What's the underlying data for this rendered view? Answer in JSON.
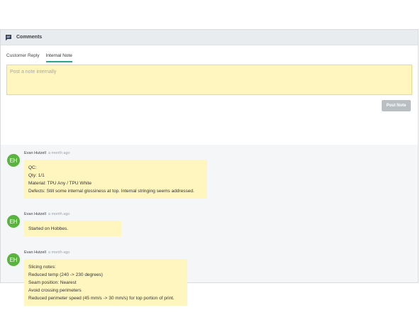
{
  "panel": {
    "title": "Comments",
    "icon": "comment-icon"
  },
  "compose": {
    "tabs": [
      {
        "label": "Customer Reply",
        "active": false
      },
      {
        "label": "Internal Note",
        "active": true
      }
    ],
    "placeholder": "Post a note internally",
    "post_button": "Post Note"
  },
  "comments": [
    {
      "initials": "EH",
      "author": "Evan Hutzell",
      "time": "a month ago",
      "lines": [
        "QC:",
        "Qty: 1/1",
        "Material: TPU Any / TPU White",
        "Defects: Still some internal glossiness at top. Internal stringing seems addressed."
      ]
    },
    {
      "initials": "EH",
      "author": "Evan Hutzell",
      "time": "a month ago",
      "lines": [
        "Started on Hobbes."
      ]
    },
    {
      "initials": "EH",
      "author": "Evan Hutzell",
      "time": "a month ago",
      "lines": [
        "Slicing notes:",
        "Reduced temp (240 -> 230 degrees)",
        "Seam position: Nearest",
        "Avoid crossing perimeters",
        "Reduced perimeter speed (45 mm/s -> 30 mm/s) for top portion of print."
      ]
    }
  ],
  "colors": {
    "accent": "#2ba68a",
    "note_bg": "#fff6bf",
    "avatar": "#5bb33f",
    "button_disabled": "#b9bec3"
  }
}
